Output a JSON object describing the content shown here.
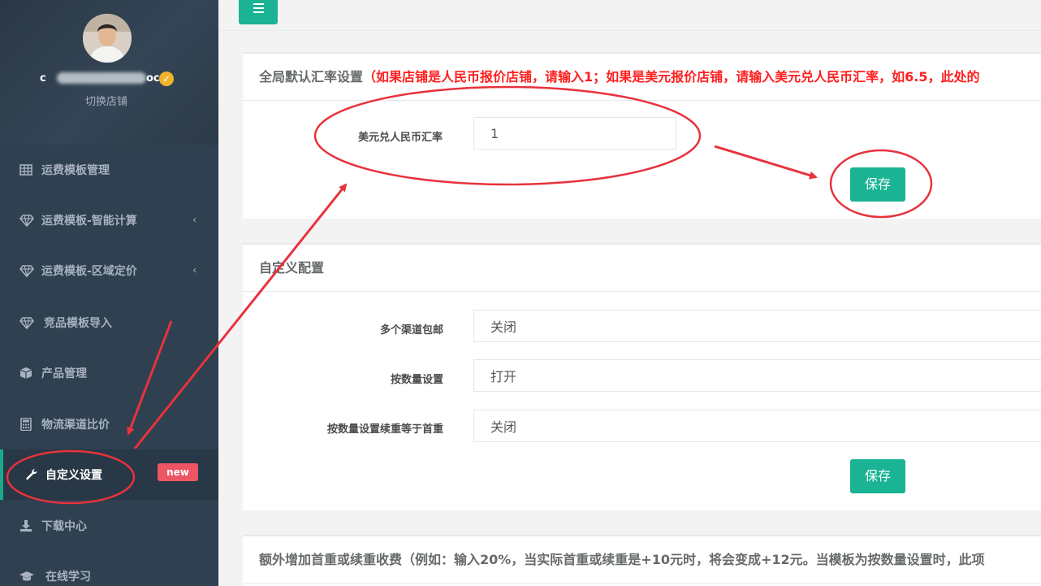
{
  "profile": {
    "username_start": "c",
    "username_end": "oc",
    "verified_mark": "✓",
    "switch_shop": "切换店铺"
  },
  "sidebar": {
    "items": [
      {
        "label": "运费模板管理",
        "icon": "grid-table-icon",
        "has_chevron": false
      },
      {
        "label": "运费模板-智能计算",
        "icon": "diamond-icon",
        "has_chevron": true
      },
      {
        "label": "运费模板-区域定价",
        "icon": "diamond-icon",
        "has_chevron": true
      },
      {
        "label": "竞品模板导入",
        "icon": "diamond-icon",
        "has_chevron": false
      },
      {
        "label": "产品管理",
        "icon": "cube-icon",
        "has_chevron": false
      },
      {
        "label": "物流渠道比价",
        "icon": "calculator-icon",
        "has_chevron": false
      },
      {
        "label": "自定义设置",
        "icon": "wrench-icon",
        "has_chevron": false,
        "active": true,
        "badge": "new"
      },
      {
        "label": "下载中心",
        "icon": "download-icon",
        "has_chevron": false
      },
      {
        "label": "在线学习",
        "icon": "graduation-cap-icon",
        "has_chevron": false
      }
    ],
    "chevron": "‹"
  },
  "exchange_panel": {
    "title": "全局默认汇率设置",
    "warning": "（如果店铺是人民币报价店铺，请输入1；如果是美元报价店铺，请输入美元兑人民币汇率，如6.5，此处的",
    "field_label": "美元兑人民币汇率",
    "field_value": "1",
    "save_label": "保存"
  },
  "custom_panel": {
    "title": "自定义配置",
    "fields": [
      {
        "label": "多个渠道包邮",
        "value": "关闭"
      },
      {
        "label": "按数量设置",
        "value": "打开"
      },
      {
        "label": "按数量设置续重等于首重",
        "value": "关闭"
      }
    ],
    "save_label": "保存"
  },
  "extra_panel": {
    "title": "额外增加首重或续重收费（例如：输入20%，当实际首重或续重是+10元时，将会变成+12元。当模板为按数量设置时，此项"
  },
  "colors": {
    "sidebar_bg": "#2f4050",
    "accent": "#1ab394",
    "warning": "#ff1f1f",
    "badge": "#ed5565",
    "annotation": "#e8323c"
  }
}
